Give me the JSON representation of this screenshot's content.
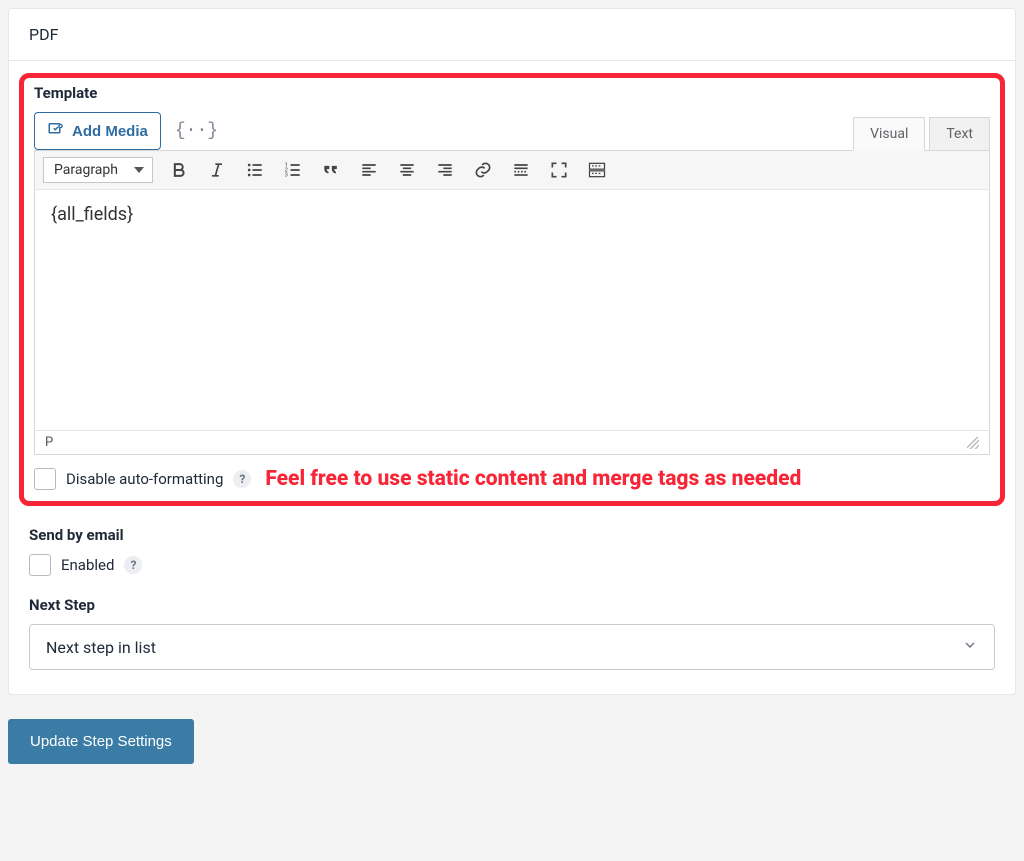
{
  "panel": {
    "title": "PDF"
  },
  "template": {
    "label": "Template",
    "add_media": "Add Media",
    "merge_tag_symbol": "{··}",
    "tabs": {
      "visual": "Visual",
      "text": "Text",
      "active": "visual"
    },
    "format_select": "Paragraph",
    "content": "{all_fields}",
    "status_path": "P",
    "disable_autoformat": {
      "label": "Disable auto-formatting",
      "checked": false,
      "help": "?"
    },
    "annotation": "Feel free to use static content and merge tags as needed"
  },
  "send_by_email": {
    "label": "Send by email",
    "enabled_label": "Enabled",
    "checked": false,
    "help": "?"
  },
  "next_step": {
    "label": "Next Step",
    "selected": "Next step in list"
  },
  "submit": {
    "label": "Update Step Settings"
  },
  "toolbar_icons": [
    "bold",
    "italic",
    "bullet-list",
    "numbered-list",
    "quote",
    "align-left",
    "align-center",
    "align-right",
    "link",
    "read-more",
    "fullscreen",
    "toolbar-toggle"
  ]
}
